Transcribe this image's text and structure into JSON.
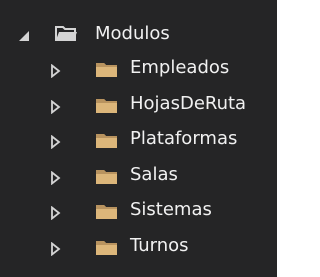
{
  "tree": {
    "root": {
      "label": "Modulos",
      "expanded": true,
      "icon": "folder-open-icon"
    },
    "children": [
      {
        "label": "Empleados",
        "expanded": false,
        "icon": "folder-icon"
      },
      {
        "label": "HojasDeRuta",
        "expanded": false,
        "icon": "folder-icon"
      },
      {
        "label": "Plataformas",
        "expanded": false,
        "icon": "folder-icon"
      },
      {
        "label": "Salas",
        "expanded": false,
        "icon": "folder-icon"
      },
      {
        "label": "Sistemas",
        "expanded": false,
        "icon": "folder-icon"
      },
      {
        "label": "Turnos",
        "expanded": false,
        "icon": "folder-icon"
      }
    ]
  },
  "colors": {
    "panel_background": "#252526",
    "text": "#f1f1f1",
    "folder": "#dcb67a",
    "folder_dark": "#b8935f",
    "expander": "#d4d4d4"
  }
}
